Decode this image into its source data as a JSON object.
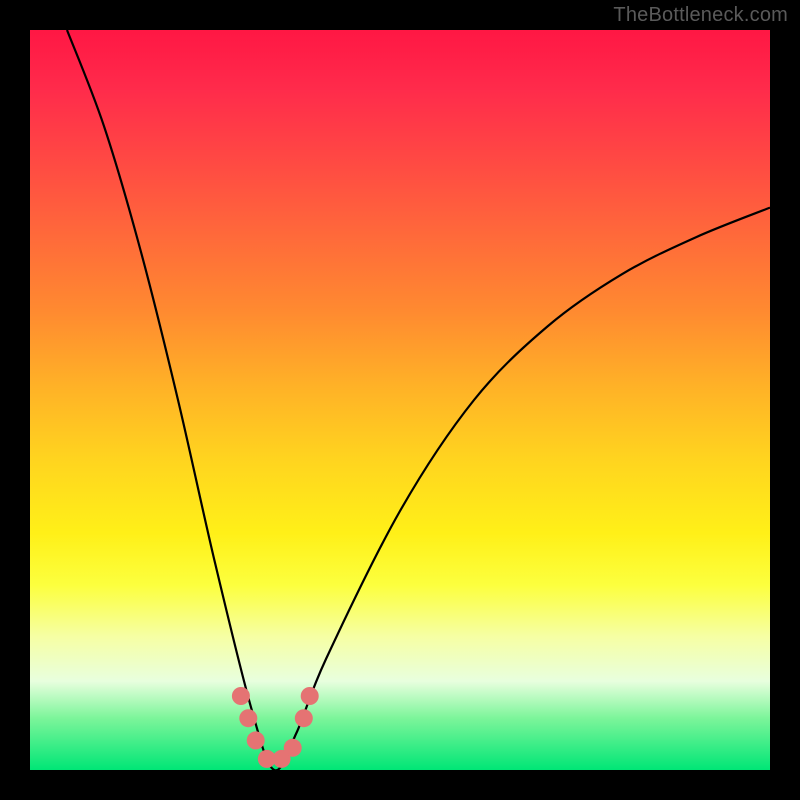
{
  "watermark": "TheBottleneck.com",
  "chart_data": {
    "type": "line",
    "title": "",
    "xlabel": "",
    "ylabel": "",
    "xlim": [
      0,
      100
    ],
    "ylim": [
      0,
      100
    ],
    "curve": {
      "minimum_x": 33,
      "points": [
        {
          "x": 5,
          "y": 100
        },
        {
          "x": 10,
          "y": 87
        },
        {
          "x": 15,
          "y": 70
        },
        {
          "x": 20,
          "y": 50
        },
        {
          "x": 25,
          "y": 28
        },
        {
          "x": 30,
          "y": 8
        },
        {
          "x": 33,
          "y": 0
        },
        {
          "x": 36,
          "y": 5
        },
        {
          "x": 40,
          "y": 15
        },
        {
          "x": 50,
          "y": 35
        },
        {
          "x": 60,
          "y": 50
        },
        {
          "x": 70,
          "y": 60
        },
        {
          "x": 80,
          "y": 67
        },
        {
          "x": 90,
          "y": 72
        },
        {
          "x": 100,
          "y": 76
        }
      ]
    },
    "markers": {
      "color": "#e57373",
      "points": [
        {
          "x": 28.5,
          "y": 10
        },
        {
          "x": 29.5,
          "y": 7
        },
        {
          "x": 30.5,
          "y": 4
        },
        {
          "x": 32,
          "y": 1.5
        },
        {
          "x": 34,
          "y": 1.5
        },
        {
          "x": 35.5,
          "y": 3
        },
        {
          "x": 37,
          "y": 7
        },
        {
          "x": 37.8,
          "y": 10
        }
      ]
    }
  }
}
